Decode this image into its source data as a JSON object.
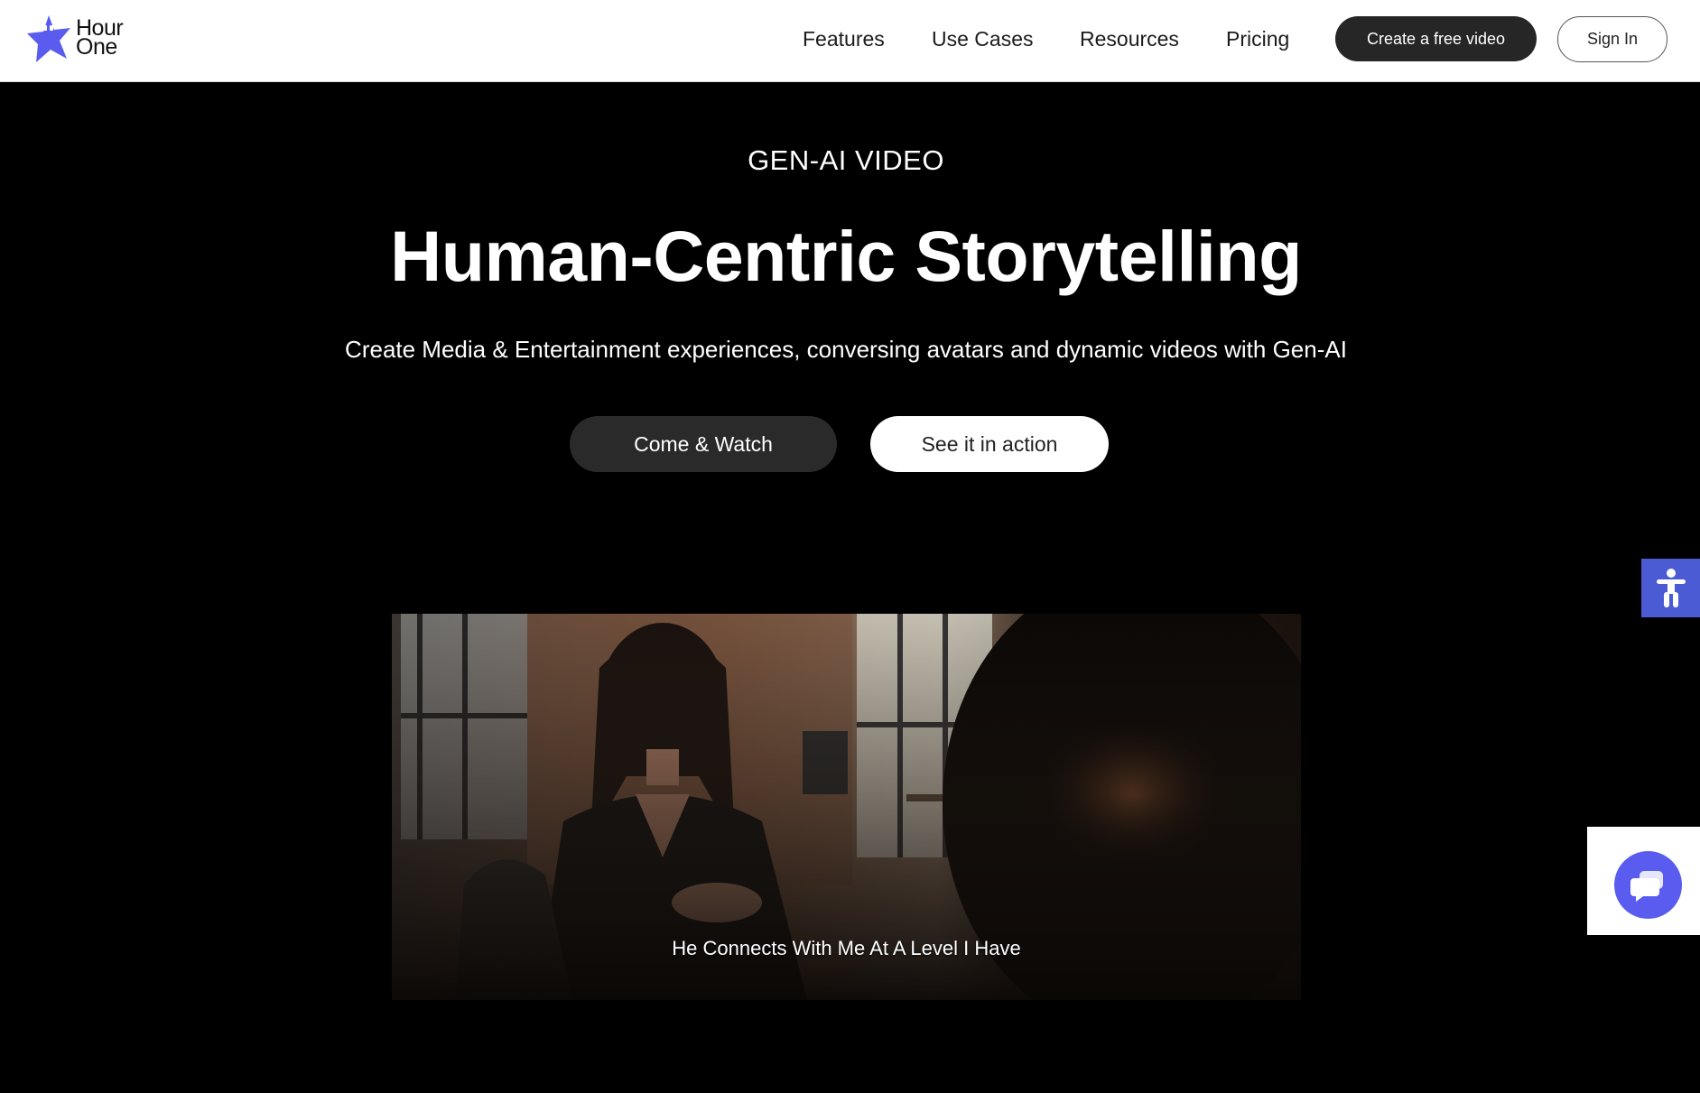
{
  "brand": {
    "name_line1": "Hour",
    "name_line2": "One",
    "logo_icon": "star-mascot-icon",
    "accent_color": "#5a5cf0"
  },
  "nav": {
    "items": [
      {
        "label": "Features"
      },
      {
        "label": "Use Cases"
      },
      {
        "label": "Resources"
      },
      {
        "label": "Pricing"
      }
    ],
    "cta_label": "Create a free video",
    "signin_label": "Sign In"
  },
  "hero": {
    "eyebrow": "GEN-AI VIDEO",
    "title": "Human-Centric Storytelling",
    "subtitle": "Create Media & Entertainment experiences, conversing avatars and dynamic videos with Gen-AI",
    "primary_button": "Come & Watch",
    "secondary_button": "See it in action"
  },
  "video": {
    "caption": "He Connects With Me At A Level I Have"
  },
  "widgets": {
    "accessibility_icon": "accessibility-icon",
    "chat_icon": "chat-bubble-icon",
    "accessibility_color": "#4a5bd4"
  }
}
